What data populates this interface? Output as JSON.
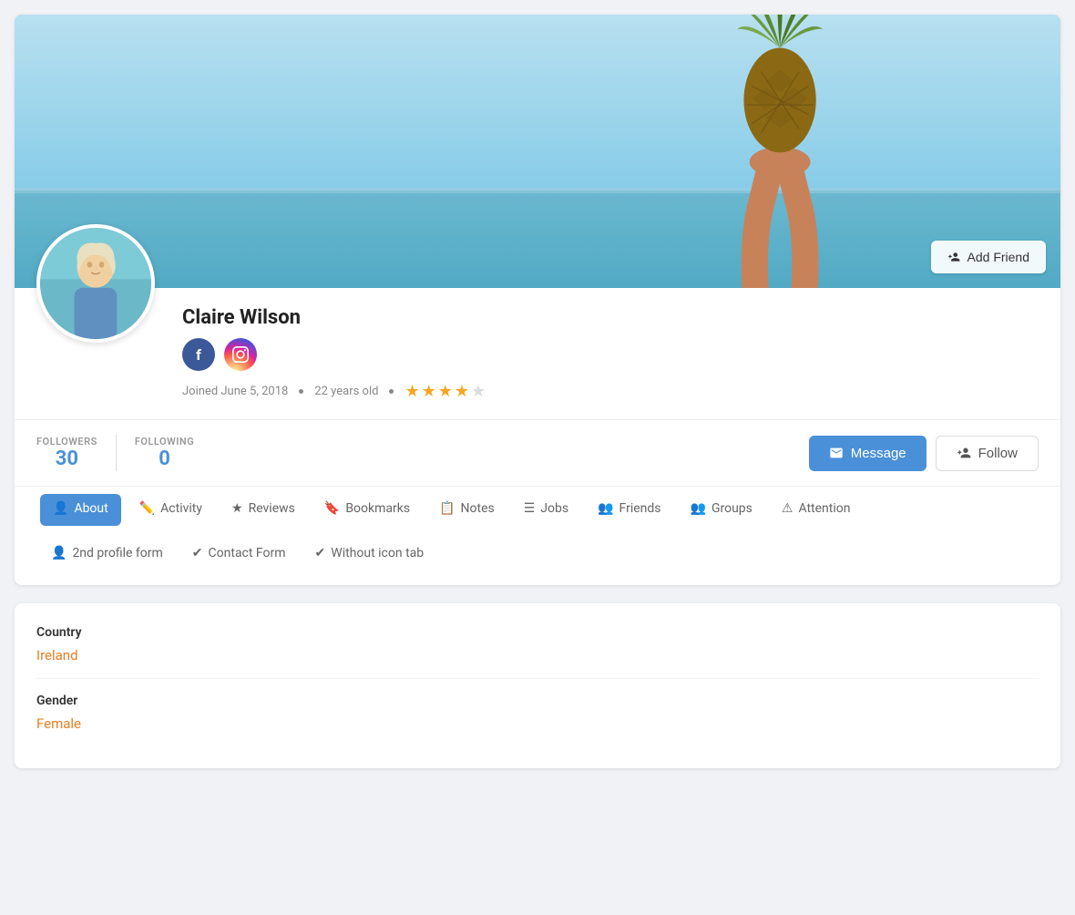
{
  "profile": {
    "name": "Claire Wilson",
    "joined": "Joined June 5, 2018",
    "age": "22 years old",
    "rating": 3.5,
    "rating_max": 5,
    "country": "Ireland",
    "gender": "Female"
  },
  "stats": {
    "followers_label": "FOLLOWERS",
    "followers_count": "30",
    "following_label": "FOLLOWING",
    "following_count": "0"
  },
  "buttons": {
    "add_friend": "Add Friend",
    "message": "Message",
    "follow": "Follow"
  },
  "tabs": {
    "row1": [
      {
        "id": "about",
        "label": "About",
        "icon": "👤",
        "active": true
      },
      {
        "id": "activity",
        "label": "Activity",
        "icon": "✏️",
        "active": false
      },
      {
        "id": "reviews",
        "label": "Reviews",
        "icon": "★",
        "active": false
      },
      {
        "id": "bookmarks",
        "label": "Bookmarks",
        "icon": "🔖",
        "active": false
      },
      {
        "id": "notes",
        "label": "Notes",
        "icon": "📋",
        "active": false
      },
      {
        "id": "jobs",
        "label": "Jobs",
        "icon": "☰",
        "active": false
      },
      {
        "id": "friends",
        "label": "Friends",
        "icon": "👥",
        "active": false
      },
      {
        "id": "groups",
        "label": "Groups",
        "icon": "👥",
        "active": false
      },
      {
        "id": "attention",
        "label": "Attention",
        "icon": "⚠",
        "active": false
      }
    ],
    "row2": [
      {
        "id": "2nd-profile-form",
        "label": "2nd profile form",
        "icon": "👤"
      },
      {
        "id": "contact-form",
        "label": "Contact Form",
        "icon": "✔"
      },
      {
        "id": "without-icon-tab",
        "label": "Without icon tab",
        "icon": "✔"
      }
    ]
  },
  "fields": [
    {
      "label": "Country",
      "value": "Ireland"
    },
    {
      "label": "Gender",
      "value": "Female"
    }
  ],
  "social": {
    "facebook_label": "f",
    "instagram_label": "📷"
  },
  "colors": {
    "primary": "#4a90d9",
    "accent": "#e67e22",
    "star_filled": "#f5a623",
    "star_empty": "#dddddd"
  }
}
